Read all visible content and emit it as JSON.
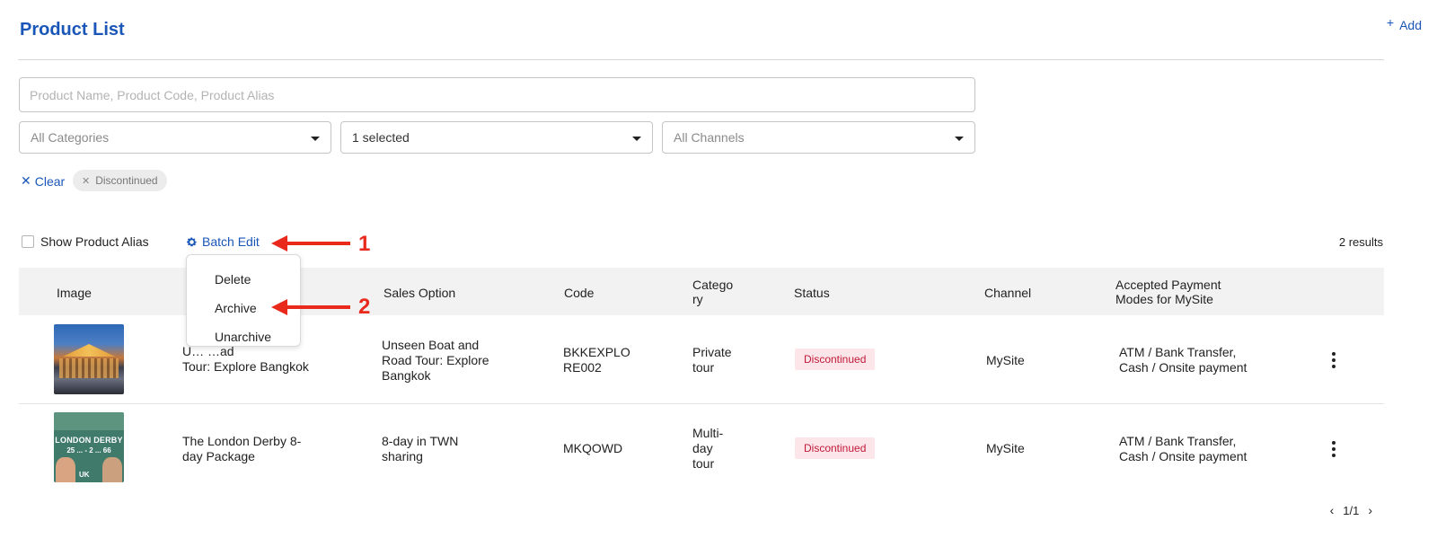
{
  "header": {
    "title": "Product List",
    "add_label": "Add"
  },
  "filters": {
    "search_placeholder": "Product Name, Product Code, Product Alias",
    "category": "All Categories",
    "status": "1 selected",
    "channel": "All Channels",
    "clear_label": "Clear",
    "active_chip": "Discontinued"
  },
  "toolbar": {
    "show_alias_label": "Show Product Alias",
    "batch_edit_label": "Batch Edit",
    "results_text": "2 results"
  },
  "batch_menu": {
    "items": [
      "Delete",
      "Archive",
      "Unarchive"
    ]
  },
  "table": {
    "columns": {
      "image": "Image",
      "sales_option": "Sales Option",
      "code": "Code",
      "category": "Catego\nry",
      "status": "Status",
      "channel": "Channel",
      "payment": "Accepted Payment\nModes for MySite"
    },
    "rows": [
      {
        "name": "U… …ad\nTour: Explore Bangkok",
        "sales_option": "Unseen Boat and\nRoad Tour: Explore\nBangkok",
        "code": "BKKEXPLO\nRE002",
        "category": "Private\ntour",
        "status": "Discontinued",
        "channel": "MySite",
        "payment": "ATM / Bank Transfer,\nCash / Onsite payment"
      },
      {
        "name": "The London Derby 8-\nday Package",
        "sales_option": "8-day in TWN\nsharing",
        "code": "MKQOWD",
        "category": "Multi-\nday\ntour",
        "status": "Discontinued",
        "channel": "MySite",
        "payment": "ATM / Bank Transfer,\nCash / Onsite payment",
        "image_text": {
          "title": "LONDON DERBY",
          "dates": "25 ... - 2 ... 66",
          "country": "UK"
        }
      }
    ]
  },
  "pagination": {
    "text": "1/1"
  },
  "annotations": {
    "label_1": "1",
    "label_2": "2"
  },
  "colors": {
    "accent": "#1a56b8",
    "danger": "#c0193a",
    "annotation": "#e8291c"
  }
}
